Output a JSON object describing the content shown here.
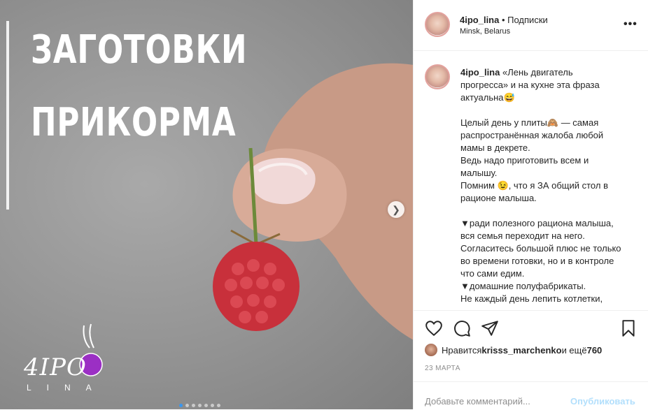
{
  "media": {
    "headline_line1": "ЗАГОТОВКИ",
    "headline_line2": "ПРИКОРМА",
    "logo_text": "4IPO",
    "logo_subtext": "LINA",
    "slide_count": 7,
    "active_slide": 1,
    "next_arrow": "chevron-right-icon"
  },
  "header": {
    "username": "4ipo_lina",
    "separator": " • ",
    "follow_label": "Подписки",
    "location": "Minsk, Belarus",
    "more": "•••"
  },
  "caption": {
    "username": "4ipo_lina",
    "lines": [
      " «Лень двигатель прогресса» и на кухне эта фраза актуальна😅",
      "",
      "Целый день у плиты🙈 — самая распространённая жалоба любой мамы в декрете.",
      "Ведь надо приготовить всем и малышу.",
      "Помним 😉, что я ЗА общий стол в рационе малыша.",
      "",
      "▼ради полезного рациона малыша, вся семья переходит на него.",
      "Согласитесь большой плюс не только во времени готовки, но и в контроле что сами едим.",
      "▼домашние полуфабрикаты.",
      "Не каждый день лепить котлетки,"
    ]
  },
  "actions": {
    "like": "heart-icon",
    "comment": "comment-icon",
    "share": "share-icon",
    "save": "bookmark-icon"
  },
  "likes": {
    "prefix": "Нравится ",
    "user": "krisss_marchenko",
    "middle": " и ещё ",
    "count": "760"
  },
  "date": "23 МАРТА",
  "comment": {
    "placeholder": "Добавьте комментарий...",
    "publish_label": "Опубликовать"
  },
  "colors": {
    "accent_blue": "#3897f0",
    "publish_disabled": "#b2dffc",
    "bullet_red": "#d93b3b"
  }
}
